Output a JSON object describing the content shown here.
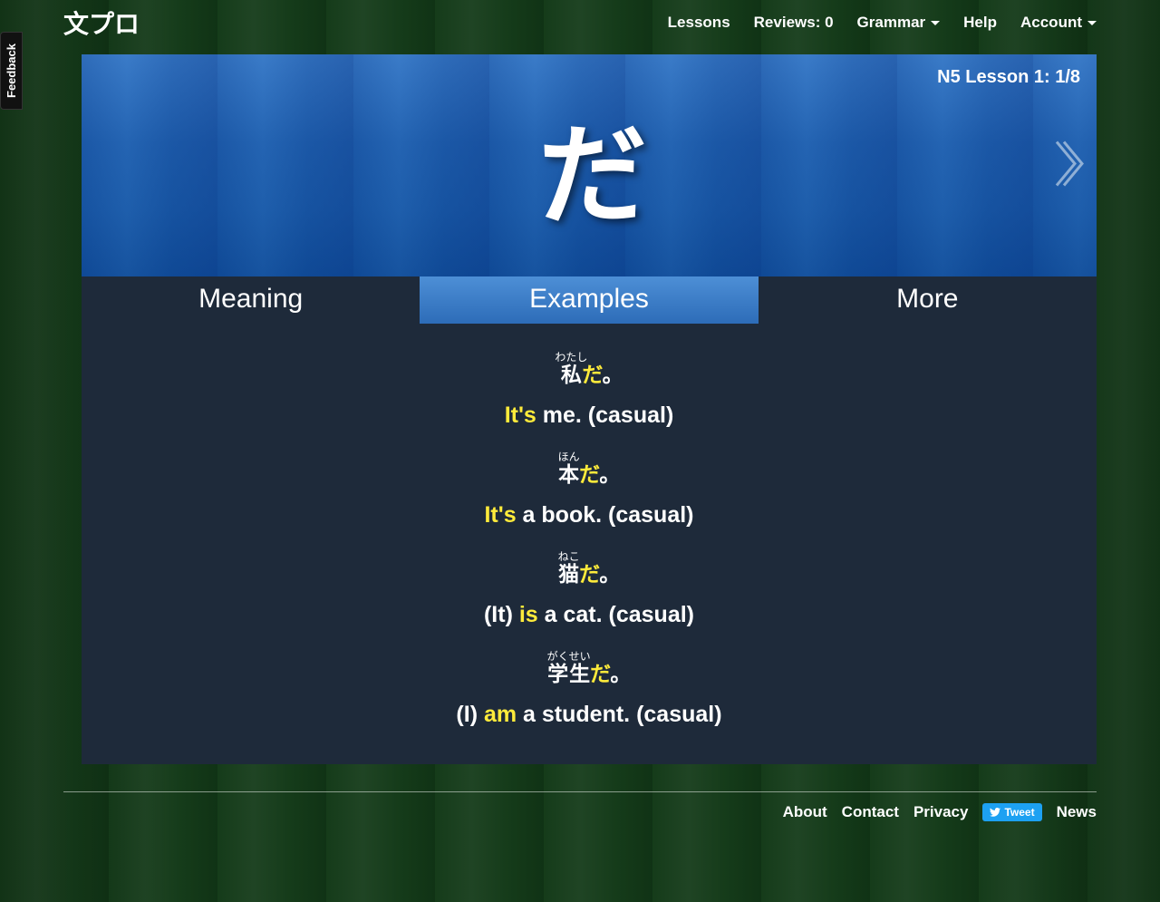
{
  "header": {
    "logo": "文プロ",
    "nav": {
      "lessons": "Lessons",
      "reviews": "Reviews: 0",
      "grammar": "Grammar",
      "help": "Help",
      "account": "Account"
    }
  },
  "feedback": "Feedback",
  "hero": {
    "lesson_label": "N5 Lesson 1: 1/8",
    "character": "だ"
  },
  "tabs": {
    "meaning": "Meaning",
    "examples": "Examples",
    "more": "More"
  },
  "examples": [
    {
      "furigana": "わたし",
      "kanji": "私",
      "grammar": "だ",
      "punct": "。",
      "en_pre": "",
      "en_hl": "It's",
      "en_post": " me. (casual)"
    },
    {
      "furigana": "ほん",
      "kanji": "本",
      "grammar": "だ",
      "punct": "。",
      "en_pre": "",
      "en_hl": "It's",
      "en_post": " a book. (casual)"
    },
    {
      "furigana": "ねこ",
      "kanji": "猫",
      "grammar": "だ",
      "punct": "。",
      "en_pre": "(It) ",
      "en_hl": "is",
      "en_post": " a cat. (casual)"
    },
    {
      "furigana": "がくせい",
      "kanji": "学生",
      "grammar": "だ",
      "punct": "。",
      "en_pre": "(I) ",
      "en_hl": "am",
      "en_post": " a student. (casual)"
    }
  ],
  "footer": {
    "about": "About",
    "contact": "Contact",
    "privacy": "Privacy",
    "tweet": "Tweet",
    "news": "News"
  }
}
